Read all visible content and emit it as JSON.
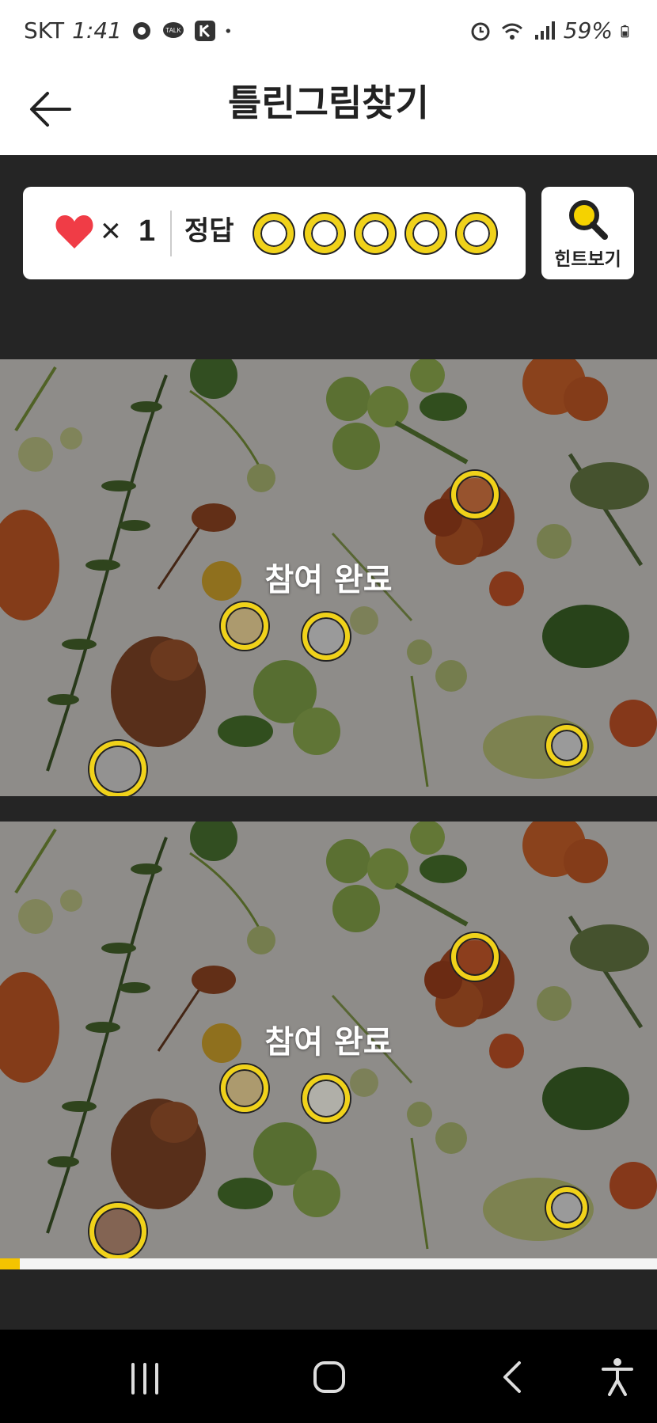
{
  "status_bar": {
    "carrier": "SKT",
    "time": "1:41",
    "battery": "59%",
    "icons": [
      "settings-icon",
      "talk-icon",
      "k-app-icon",
      "dot-icon",
      "alarm-icon",
      "wifi-icon",
      "signal-icon",
      "battery-icon"
    ]
  },
  "header": {
    "title": "틀린그림찾기",
    "back_icon": "back-arrow-icon"
  },
  "score_panel": {
    "lives_symbol": "×",
    "lives_count": "1",
    "answer_label": "정답",
    "answer_slots": 5,
    "heart_color": "#f03c46",
    "slot_color": "#f0d21a"
  },
  "hint_button": {
    "label": "힌트보기",
    "icon": "magnifier-icon"
  },
  "scenes": [
    {
      "status_text": "참여 완료",
      "found_markers": 5
    },
    {
      "status_text": "참여 완료",
      "found_markers": 5
    }
  ],
  "progress": {
    "value": 0.03,
    "color": "#f4c400"
  },
  "nav_bar": {
    "icons": [
      "recent-apps-icon",
      "home-icon",
      "nav-back-icon",
      "accessibility-icon"
    ]
  }
}
